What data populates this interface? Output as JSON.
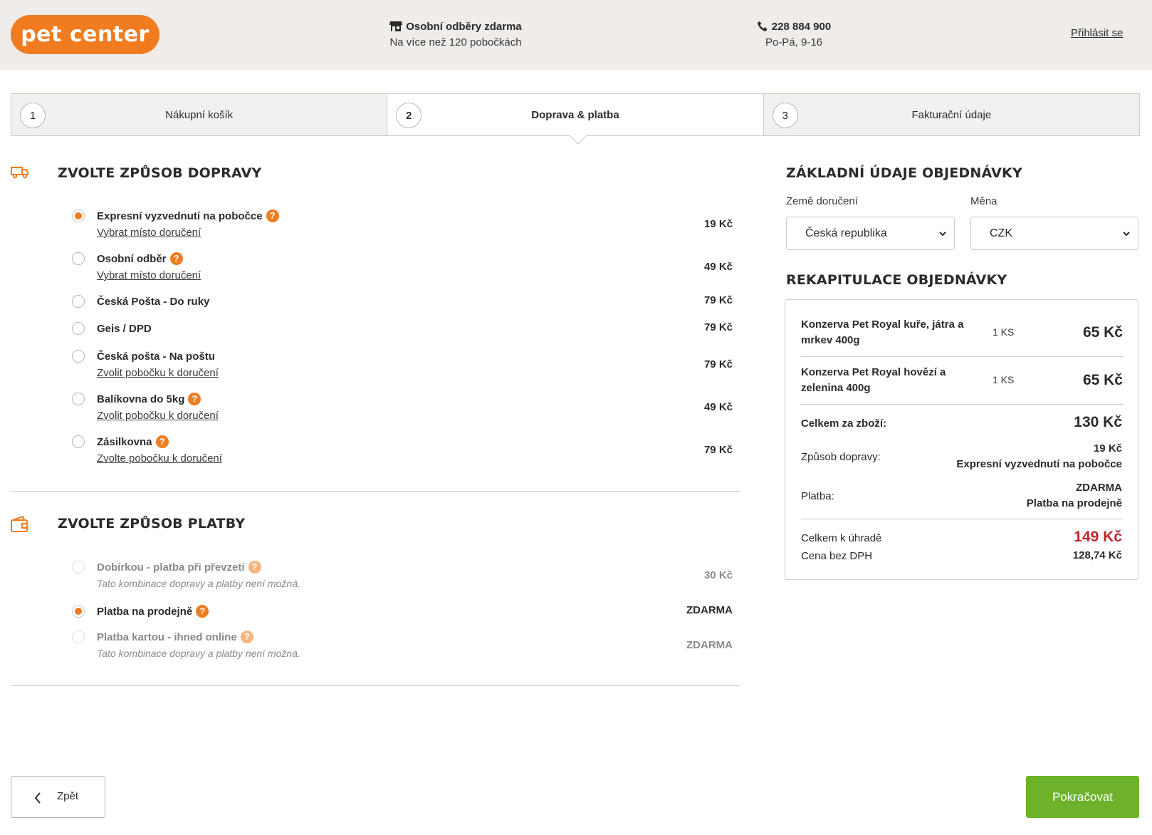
{
  "header": {
    "logo": "pet center",
    "pickup_title": "Osobní odběry zdarma",
    "pickup_sub": "Na více než 120 pobočkách",
    "phone": "228 884 900",
    "hours": "Po-Pá, 9-16",
    "login": "Přihlásit se"
  },
  "steps": [
    {
      "num": "1",
      "label": "Nákupní košík"
    },
    {
      "num": "2",
      "label": "Doprava & platba"
    },
    {
      "num": "3",
      "label": "Fakturační údaje"
    }
  ],
  "shipping": {
    "title": "ZVOLTE ZPŮSOB DOPRAVY",
    "options": [
      {
        "name": "Expresní vyzvednutí na pobočce",
        "link": "Vybrat místo doručení",
        "price": "19 Kč",
        "selected": true
      },
      {
        "name": "Osobní odběr",
        "link": "Vybrat místo doručení",
        "price": "49 Kč",
        "selected": false
      },
      {
        "name": "Česká Pošta - Do ruky",
        "link": "",
        "price": "79 Kč",
        "selected": false
      },
      {
        "name": "Geis / DPD",
        "link": "",
        "price": "79 Kč",
        "selected": false
      },
      {
        "name": "Česká pošta - Na poštu",
        "link": "Zvolit pobočku k doručení",
        "price": "79 Kč",
        "selected": false
      },
      {
        "name": "Balíkovna do 5kg",
        "link": "Zvolit pobočku k doručení",
        "price": "49 Kč",
        "selected": false
      },
      {
        "name": "Zásilkovna",
        "link": "Zvolte pobočku k doručení",
        "price": "79 Kč",
        "selected": false
      }
    ]
  },
  "payment": {
    "title": "ZVOLTE ZPŮSOB PLATBY",
    "options": [
      {
        "name": "Dobírkou - platba při převzetí",
        "note": "Tato kombinace dopravy a platby není možná.",
        "price": "30 Kč",
        "selected": false,
        "disabled": true
      },
      {
        "name": "Platba na prodejně",
        "note": "",
        "price": "ZDARMA",
        "selected": true,
        "disabled": false
      },
      {
        "name": "Platba kartou - ihned online",
        "note": "Tato kombinace dopravy a platby není možná.",
        "price": "ZDARMA",
        "selected": false,
        "disabled": true
      }
    ]
  },
  "order_basics": {
    "title": "ZÁKLADNÍ ÚDAJE OBJEDNÁVKY",
    "country_label": "Země doručení",
    "country_value": "Česká republika",
    "currency_label": "Měna",
    "currency_value": "CZK"
  },
  "recap": {
    "title": "REKAPITULACE OBJEDNÁVKY",
    "items": [
      {
        "name": "Konzerva Pet Royal kuře, játra a mrkev 400g",
        "qty": "1 KS",
        "price": "65 Kč"
      },
      {
        "name": "Konzerva Pet Royal hovězí a zelenina 400g",
        "qty": "1 KS",
        "price": "65 Kč"
      }
    ],
    "goods_total_label": "Celkem za zboží:",
    "goods_total": "130 Kč",
    "shipping_label": "Způsob dopravy:",
    "shipping_price": "19 Kč",
    "shipping_name": "Expresní vyzvednutí na pobočce",
    "payment_label": "Platba:",
    "payment_price": "ZDARMA",
    "payment_name": "Platba na prodejně",
    "total_label": "Celkem k úhradě",
    "total": "149 Kč",
    "net_label": "Cena bez DPH",
    "net": "128,74 Kč"
  },
  "footer": {
    "back": "Zpět",
    "next": "Pokračovat"
  },
  "colors": {
    "brand_orange": "#f07c1f",
    "total_red": "#c0272d",
    "continue_green": "#6db22a"
  }
}
